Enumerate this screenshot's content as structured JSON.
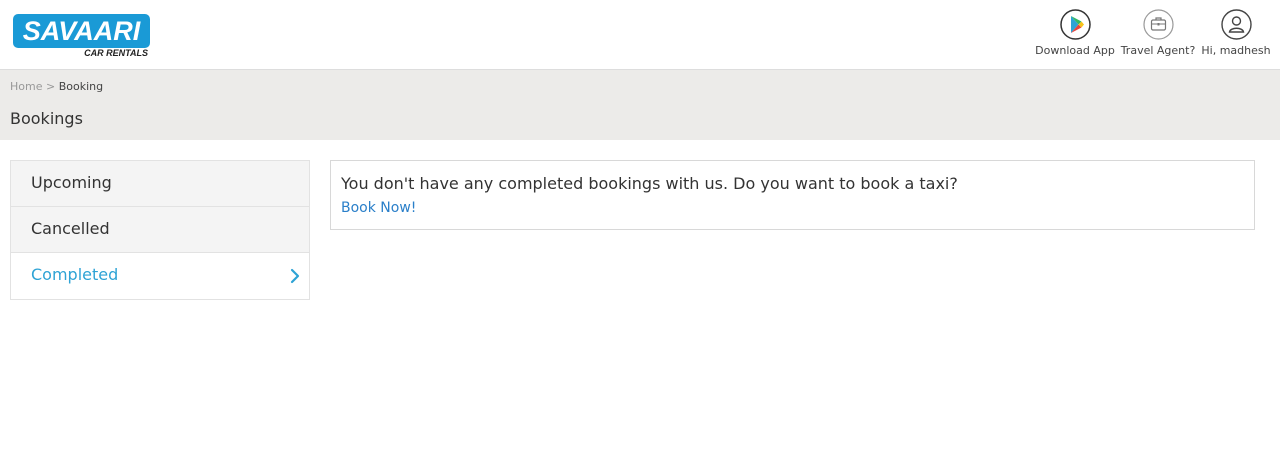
{
  "brand": {
    "name": "SAVAARI",
    "tagline": "CAR RENTALS",
    "color": "#1a9ad6"
  },
  "header": {
    "actions": [
      {
        "label": "Download App",
        "icon": "play-store-icon"
      },
      {
        "label": "Travel Agent?",
        "icon": "briefcase-icon"
      },
      {
        "label": "Hi, madhesh",
        "icon": "user-icon"
      }
    ]
  },
  "breadcrumb": {
    "home": "Home",
    "separator": ">",
    "current": "Booking"
  },
  "page": {
    "title": "Bookings"
  },
  "tabs": [
    {
      "label": "Upcoming",
      "active": false
    },
    {
      "label": "Cancelled",
      "active": false
    },
    {
      "label": "Completed",
      "active": true,
      "icon": "chevron-right-icon"
    }
  ],
  "content": {
    "message": "You don't have any completed bookings with us. Do you want to book a taxi?",
    "link_label": "Book Now!"
  },
  "colors": {
    "accent": "#2ea3d5",
    "link": "#2a7fc9",
    "band": "#ecebe9"
  }
}
